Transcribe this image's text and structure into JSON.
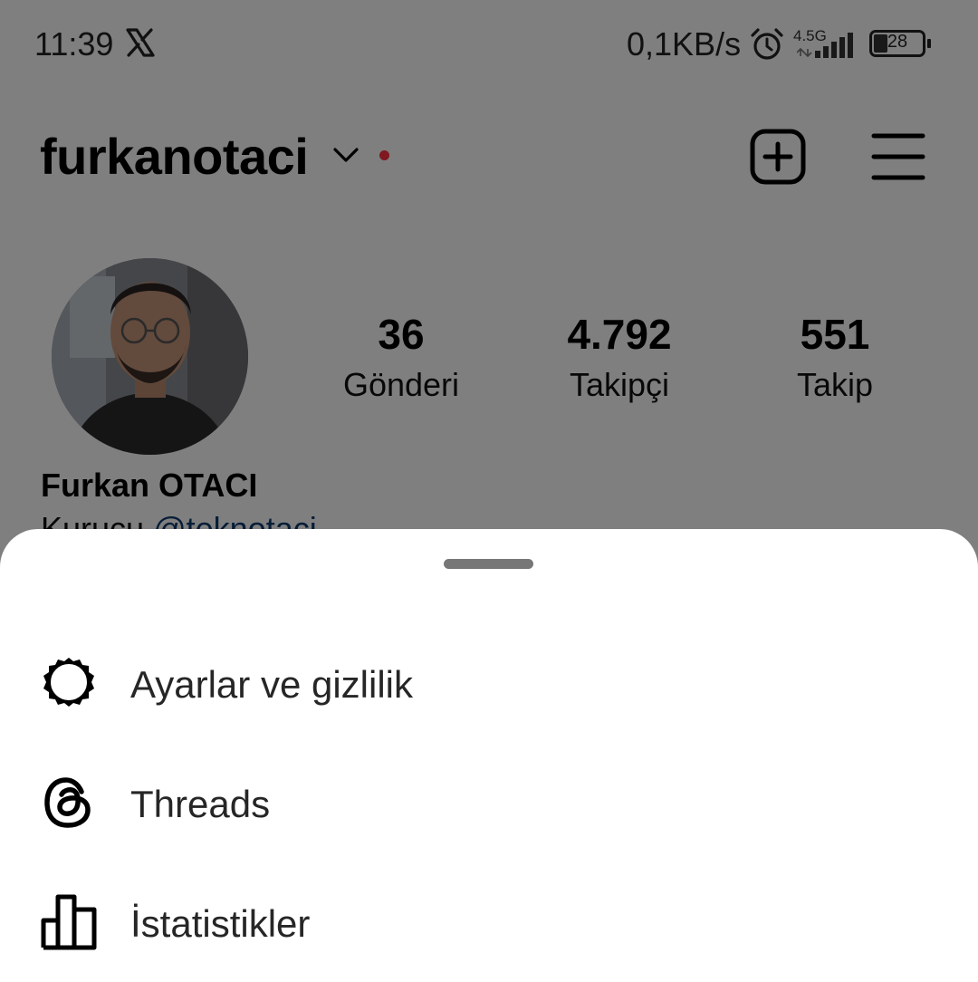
{
  "status_bar": {
    "time": "11:39",
    "network_speed": "0,1KB/s",
    "network_type": "4.5G",
    "battery": "28",
    "battery_percent": 28,
    "icons": [
      "x-logo-icon",
      "alarm-clock-icon",
      "signal-icon",
      "battery-icon"
    ]
  },
  "profile": {
    "username": "furkanotaci",
    "full_name": "Furkan OTACI",
    "bio_prefix": "Kurucu",
    "bio_mention": "@teknotaci",
    "stats": [
      {
        "value": "36",
        "label": "Gönderi"
      },
      {
        "value": "4.792",
        "label": "Takipçi"
      },
      {
        "value": "551",
        "label": "Takip"
      }
    ],
    "notification_dot_color": "#ff3040",
    "mention_color": "#0d3a6e"
  },
  "sheet": {
    "items": [
      {
        "label": "Ayarlar ve gizlilik",
        "icon": "gear-icon"
      },
      {
        "label": "Threads",
        "icon": "threads-icon"
      },
      {
        "label": "İstatistikler",
        "icon": "bar-chart-icon"
      }
    ]
  },
  "colors": {
    "scrim": "rgba(0,0,0,0.5)",
    "sheet_background": "#ffffff",
    "text_primary": "#262626"
  }
}
